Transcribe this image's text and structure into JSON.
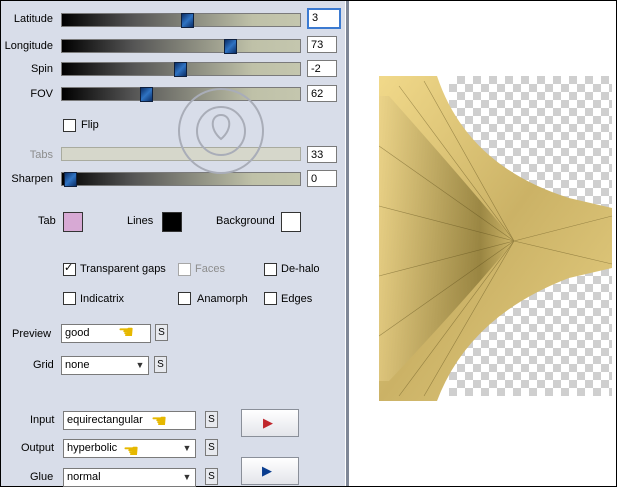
{
  "sliders": {
    "latitude": {
      "label": "Latitude",
      "value": "3",
      "fill": 0.52
    },
    "longitude": {
      "label": "Longitude",
      "value": "73",
      "fill": 0.7
    },
    "spin": {
      "label": "Spin",
      "value": "-2",
      "fill": 0.49
    },
    "fov": {
      "label": "FOV",
      "value": "62",
      "fill": 0.35
    },
    "tabs": {
      "label": "Tabs",
      "value": "33",
      "fill": 0.0
    },
    "sharpen": {
      "label": "Sharpen",
      "value": "0",
      "fill": 0.03
    }
  },
  "flip": {
    "label": "Flip",
    "checked": false
  },
  "colors": {
    "tab": {
      "label": "Tab",
      "color": "#d7a9d4"
    },
    "lines": {
      "label": "Lines",
      "color": "#000000"
    },
    "background": {
      "label": "Background",
      "color": "#ffffff"
    }
  },
  "options": {
    "transparent_gaps": {
      "label": "Transparent gaps",
      "checked": true
    },
    "faces": {
      "label": "Faces",
      "checked": false
    },
    "de_halo": {
      "label": "De-halo",
      "checked": false
    },
    "indicatrix": {
      "label": "Indicatrix",
      "checked": false
    },
    "anamorph": {
      "label": "Anamorph",
      "checked": false
    },
    "edges": {
      "label": "Edges",
      "checked": false
    }
  },
  "preview": {
    "label": "Preview",
    "value": "good",
    "s": "S"
  },
  "grid": {
    "label": "Grid",
    "value": "none",
    "s": "S"
  },
  "input": {
    "label": "Input",
    "value": "equirectangular",
    "s": "S"
  },
  "output": {
    "label": "Output",
    "value": "hyperbolic",
    "s": "S"
  },
  "glue": {
    "label": "Glue",
    "value": "normal",
    "s": "S"
  },
  "icons": [
    "pointing-hand-icon",
    "render-arrow-icon",
    "play-sphere-icon",
    "watermark-seal"
  ],
  "accent": "#e6b800"
}
